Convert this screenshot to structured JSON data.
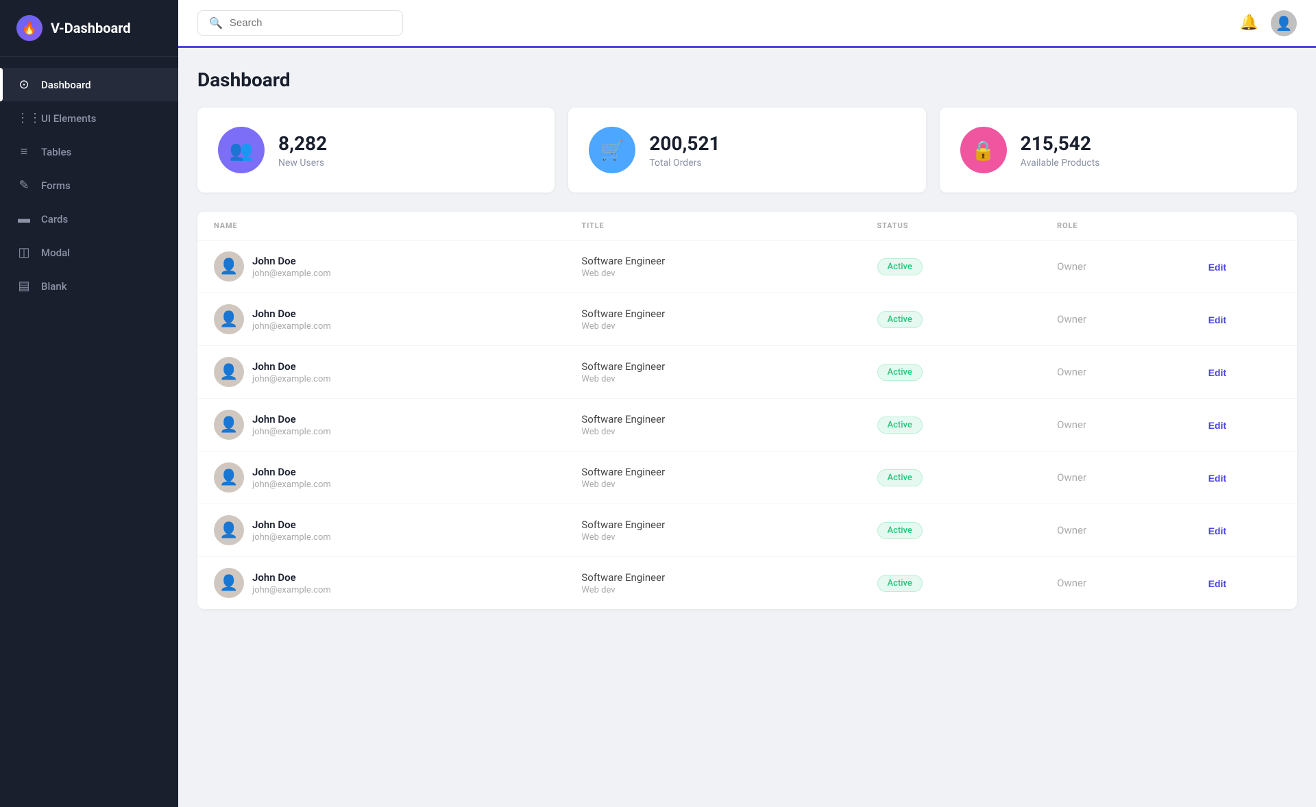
{
  "sidebar": {
    "logo_icon": "🔥",
    "logo_text": "V-Dashboard",
    "nav_items": [
      {
        "id": "dashboard",
        "label": "Dashboard",
        "icon": "⊙",
        "active": true
      },
      {
        "id": "ui-elements",
        "label": "UI Elements",
        "icon": "⋮⋮",
        "active": false
      },
      {
        "id": "tables",
        "label": "Tables",
        "icon": "≡",
        "active": false
      },
      {
        "id": "forms",
        "label": "Forms",
        "icon": "✎",
        "active": false
      },
      {
        "id": "cards",
        "label": "Cards",
        "icon": "▬",
        "active": false
      },
      {
        "id": "modal",
        "label": "Modal",
        "icon": "◫",
        "active": false
      },
      {
        "id": "blank",
        "label": "Blank",
        "icon": "▤",
        "active": false
      }
    ]
  },
  "header": {
    "search_placeholder": "Search",
    "bell_icon": "🔔"
  },
  "page": {
    "title": "Dashboard"
  },
  "stats": [
    {
      "id": "new-users",
      "icon": "👥",
      "icon_bg": "#7c6ef7",
      "number": "8,282",
      "label": "New Users"
    },
    {
      "id": "total-orders",
      "icon": "🛒",
      "icon_bg": "#4da6ff",
      "number": "200,521",
      "label": "Total Orders"
    },
    {
      "id": "available-products",
      "icon": "🔒",
      "icon_bg": "#f056a0",
      "number": "215,542",
      "label": "Available Products"
    }
  ],
  "table": {
    "columns": [
      "Name",
      "Title",
      "Status",
      "Role",
      ""
    ],
    "col_keys": [
      "name",
      "title",
      "status",
      "role",
      "action"
    ],
    "rows": [
      {
        "name": "John Doe",
        "email": "john@example.com",
        "title_main": "Software Engineer",
        "title_sub": "Web dev",
        "status": "Active",
        "role": "Owner",
        "action": "Edit"
      },
      {
        "name": "John Doe",
        "email": "john@example.com",
        "title_main": "Software Engineer",
        "title_sub": "Web dev",
        "status": "Active",
        "role": "Owner",
        "action": "Edit"
      },
      {
        "name": "John Doe",
        "email": "john@example.com",
        "title_main": "Software Engineer",
        "title_sub": "Web dev",
        "status": "Active",
        "role": "Owner",
        "action": "Edit"
      },
      {
        "name": "John Doe",
        "email": "john@example.com",
        "title_main": "Software Engineer",
        "title_sub": "Web dev",
        "status": "Active",
        "role": "Owner",
        "action": "Edit"
      },
      {
        "name": "John Doe",
        "email": "john@example.com",
        "title_main": "Software Engineer",
        "title_sub": "Web dev",
        "status": "Active",
        "role": "Owner",
        "action": "Edit"
      },
      {
        "name": "John Doe",
        "email": "john@example.com",
        "title_main": "Software Engineer",
        "title_sub": "Web dev",
        "status": "Active",
        "role": "Owner",
        "action": "Edit"
      },
      {
        "name": "John Doe",
        "email": "john@example.com",
        "title_main": "Software Engineer",
        "title_sub": "Web dev",
        "status": "Active",
        "role": "Owner",
        "action": "Edit"
      }
    ]
  }
}
